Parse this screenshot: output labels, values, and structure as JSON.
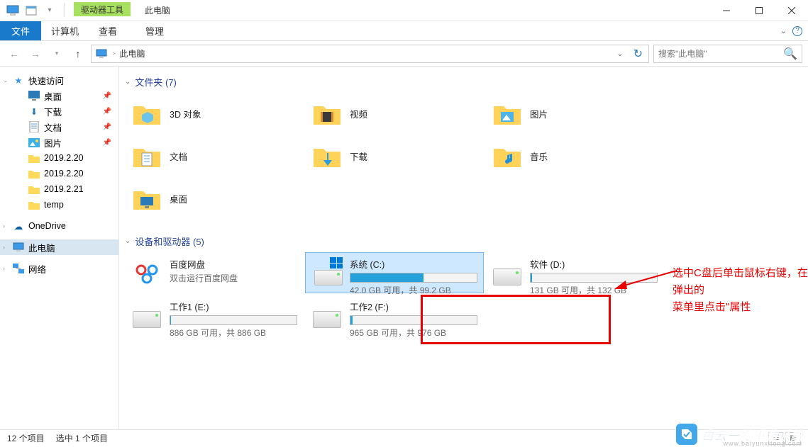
{
  "title": "此电脑",
  "ribbon_context": "驱动器工具",
  "ribbon_context_sub": "管理",
  "tabs": {
    "file": "文件",
    "computer": "计算机",
    "view": "查看"
  },
  "breadcrumb": "此电脑",
  "search_placeholder": "搜索\"此电脑\"",
  "sidebar": {
    "quick_access": "快速访问",
    "desktop": "桌面",
    "downloads": "下载",
    "documents": "文档",
    "pictures": "图片",
    "f1": "2019.2.20",
    "f2": "2019.2.20",
    "f3": "2019.2.21",
    "f4": "temp",
    "onedrive": "OneDrive",
    "this_pc": "此电脑",
    "network": "网络"
  },
  "groups": {
    "folders_header": "文件夹 (7)",
    "drives_header": "设备和驱动器 (5)"
  },
  "folders": {
    "3dobjects": "3D 对象",
    "videos": "视频",
    "pictures": "图片",
    "documents": "文档",
    "downloads": "下载",
    "music": "音乐",
    "desktop": "桌面"
  },
  "baidu": {
    "name": "百度网盘",
    "sub": "双击运行百度网盘"
  },
  "drives": {
    "c": {
      "name": "系统 (C:)",
      "stats": "42.0 GB 可用，共 99.2 GB",
      "fill": 58
    },
    "d": {
      "name": "软件 (D:)",
      "stats": "131 GB 可用，共 132 GB",
      "fill": 1
    },
    "e": {
      "name": "工作1 (E:)",
      "stats": "886 GB 可用，共 886 GB",
      "fill": 0.5
    },
    "f": {
      "name": "工作2 (F:)",
      "stats": "965 GB 可用，共 976 GB",
      "fill": 1.5
    }
  },
  "annotation": {
    "line1": "选中C盘后单击鼠标右键，在弹出的",
    "line2": "菜单里点击\"属性"
  },
  "status": {
    "items": "12 个项目",
    "selected": "选中 1 个项目"
  },
  "watermark": {
    "text": "白云一键重装系统",
    "url": "www.baiyunxitong.com"
  }
}
